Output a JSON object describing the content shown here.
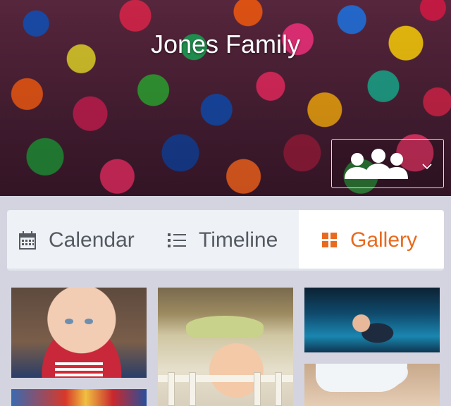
{
  "header": {
    "title": "Jones Family",
    "members_button_icon": "group-icon",
    "dropdown_icon": "chevron-down-icon"
  },
  "tabs": [
    {
      "label": "Calendar",
      "icon": "calendar-icon",
      "active": false
    },
    {
      "label": "Timeline",
      "icon": "list-icon",
      "active": false
    },
    {
      "label": "Gallery",
      "icon": "grid-icon",
      "active": true
    }
  ],
  "colors": {
    "accent": "#e86a1f",
    "tab_text": "#555a62",
    "tab_bar": "#eef1f5",
    "page_background": "#d4d4e0"
  },
  "gallery": {
    "photos": [
      {
        "subject": "baby portrait"
      },
      {
        "subject": "baby in crib"
      },
      {
        "subject": "baby in pool"
      },
      {
        "subject": "baby with hat"
      },
      {
        "subject": "baby in colorful outfit"
      }
    ]
  }
}
